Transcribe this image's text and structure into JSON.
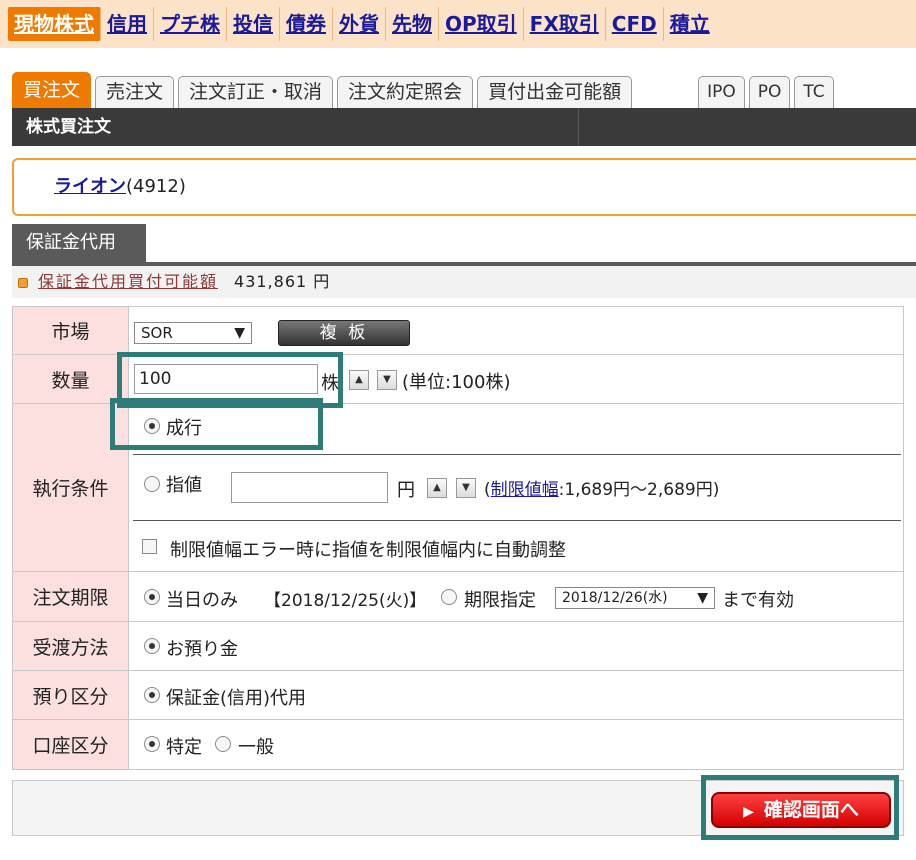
{
  "topnav": {
    "items": [
      "現物株式",
      "信用",
      "プチ株",
      "投信",
      "債券",
      "外貨",
      "先物",
      "OP取引",
      "FX取引",
      "CFD",
      "積立"
    ],
    "active_index": 0
  },
  "subtabs": {
    "items": [
      "買注文",
      "売注文",
      "注文訂正・取消",
      "注文約定照会",
      "買付出金可能額"
    ],
    "right_items": [
      "IPO",
      "PO",
      "TC"
    ],
    "active_index": 0
  },
  "section": {
    "title": "株式買注文"
  },
  "stock": {
    "name": "ライオン",
    "code": "(4912)"
  },
  "margin": {
    "tab_label": "保証金代用",
    "row_label": "保証金代用買付可能額",
    "amount": "431,861 円"
  },
  "form": {
    "market": {
      "label": "市場",
      "value": "SOR",
      "board_button": "複 板"
    },
    "quantity": {
      "label": "数量",
      "value": "100",
      "unit": "株",
      "note": "(単位:100株)"
    },
    "execution": {
      "label": "執行条件",
      "market_order": "成行",
      "limit_order": "指値",
      "yen": "円",
      "range_prefix": "(",
      "range_link": "制限値幅",
      "range_text": ":1,689円〜2,689円)",
      "auto_adjust": "制限値幅エラー時に指値を制限値幅内に自動調整",
      "selected": "market"
    },
    "period": {
      "label": "注文期限",
      "today_only": "当日のみ",
      "today_date": "【2018/12/25(火)】",
      "specify": "期限指定",
      "specify_date": "2018/12/26(水)",
      "valid_until": "まで有効"
    },
    "delivery": {
      "label": "受渡方法",
      "option": "お預り金"
    },
    "deposit": {
      "label": "預り区分",
      "option": "保証金(信用)代用"
    },
    "account": {
      "label": "口座区分",
      "specific": "特定",
      "general": "一般"
    }
  },
  "confirm": {
    "label": "確認画面へ"
  },
  "colors": {
    "accent": "#ee7a00",
    "highlight": "#2e7c7a",
    "confirm": "#e00000"
  }
}
